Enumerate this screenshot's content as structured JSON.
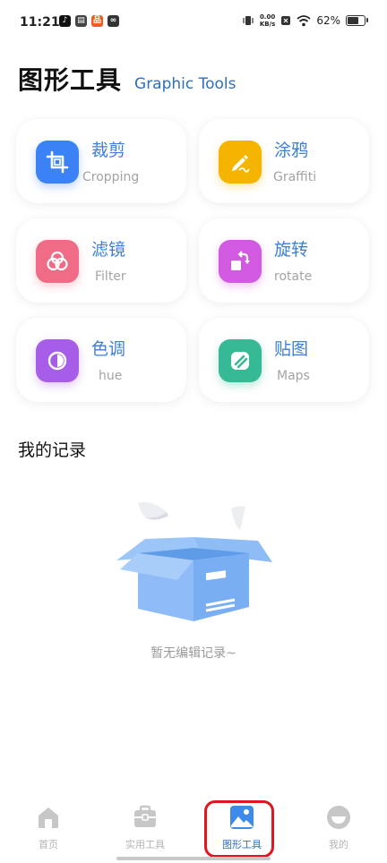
{
  "status_bar": {
    "time": "11:21",
    "net_speed_value": "0.00",
    "net_speed_unit": "KB/s",
    "battery": "62%",
    "battery_level": 0.62
  },
  "header": {
    "title_cn": "图形工具",
    "title_en": "Graphic Tools"
  },
  "tools": [
    {
      "cn": "裁剪",
      "en": "Cropping",
      "icon": "crop-icon",
      "color": "#3b82f6"
    },
    {
      "cn": "涂鸦",
      "en": "Graffiti",
      "icon": "pen-icon",
      "color": "#f5b400"
    },
    {
      "cn": "滤镜",
      "en": "Filter",
      "icon": "filter-icon",
      "color": "#ef6b86"
    },
    {
      "cn": "旋转",
      "en": "rotate",
      "icon": "rotate-icon",
      "color": "#d25ae0"
    },
    {
      "cn": "色调",
      "en": "hue",
      "icon": "hue-icon",
      "color": "#a65ee8"
    },
    {
      "cn": "贴图",
      "en": "Maps",
      "icon": "sticker-icon",
      "color": "#36b995"
    }
  ],
  "records": {
    "title": "我的记录",
    "empty_text": "暂无编辑记录~"
  },
  "bottom_nav": [
    {
      "label": "首页",
      "icon": "home-icon",
      "active": false
    },
    {
      "label": "实用工具",
      "icon": "toolbox-icon",
      "active": false
    },
    {
      "label": "图形工具",
      "icon": "image-icon",
      "active": true
    },
    {
      "label": "我的",
      "icon": "profile-icon",
      "active": false
    }
  ],
  "colors": {
    "accent": "#2d6fbf",
    "highlight": "#e0171f"
  }
}
